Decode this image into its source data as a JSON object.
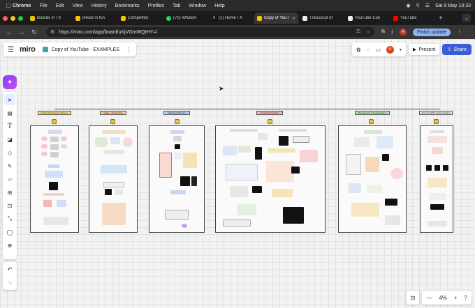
{
  "menubar": {
    "items": [
      "Chrome",
      "File",
      "Edit",
      "View",
      "History",
      "Bookmarks",
      "Profiles",
      "Tab",
      "Window",
      "Help"
    ],
    "datetime": "Sat 9 May  10:33"
  },
  "tabs": [
    {
      "label": "Boards in Th",
      "color": "#f5c400"
    },
    {
      "label": "linked in fun",
      "color": "#f5c400"
    },
    {
      "label": "Competitor",
      "color": "#f5c400"
    },
    {
      "label": "(70) WhatsA",
      "color": "#25d366"
    },
    {
      "label": "(1) Home / X",
      "color": "#111111"
    },
    {
      "label": "Copy of YouT",
      "color": "#f5c400"
    },
    {
      "label": "Transcript of",
      "color": "#eeeeee"
    },
    {
      "label": "YouTube Con",
      "color": "#eeeeee"
    },
    {
      "label": "YouTube",
      "color": "#ff0000"
    }
  ],
  "address": {
    "url": "https://miro.com/app/board/uXjVGmWQtHY=/",
    "profile_initial": "A",
    "finish_update": "Finish update"
  },
  "miro": {
    "logo": "miro",
    "board_title": "Copy of YouTube - EXAMPLES",
    "present": "Present",
    "share": "Share",
    "avatar_initial": "A",
    "zoom": "4%"
  },
  "board": {
    "frames": [
      {
        "label": "Finding Fundraisers Online to SBD.com"
      },
      {
        "label": "Video + Prospecting"
      },
      {
        "label": "Marketing Planning"
      },
      {
        "label": "Content Production"
      },
      {
        "label": "Management & Idea Execution"
      },
      {
        "label": "Reporting BTF Implementation"
      }
    ]
  }
}
